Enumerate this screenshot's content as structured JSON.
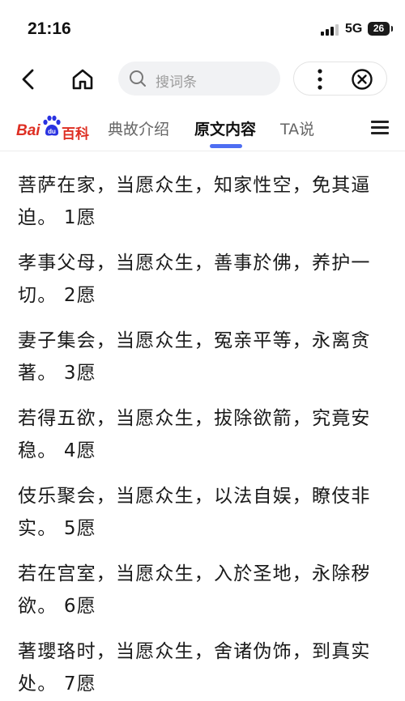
{
  "status_bar": {
    "time": "21:16",
    "network": "5G",
    "battery": "26"
  },
  "nav": {
    "search_placeholder": "搜词条",
    "icons": {
      "back": "chevron-left-icon",
      "home": "home-icon",
      "search": "search-icon",
      "more": "more-vertical-icon",
      "close": "close-circle-icon"
    }
  },
  "tabs": {
    "logo_bai": "Bai",
    "logo_ke": "百科",
    "items": [
      "典故介绍",
      "原文内容",
      "TA说"
    ],
    "active": "原文内容"
  },
  "content": {
    "paragraphs": [
      {
        "line1": "菩萨在家，当愿众生，知家性空，免其逼",
        "line2": "迫。 1愿"
      },
      {
        "line1": "孝事父母，当愿众生，善事於佛，养护一",
        "line2": "切。 2愿"
      },
      {
        "line1": "妻子集会，当愿众生，冤亲平等，永离贪",
        "line2": "著。 3愿"
      },
      {
        "line1": "若得五欲，当愿众生，拔除欲箭，究竟安",
        "line2": "稳。 4愿"
      },
      {
        "line1": "伎乐聚会，当愿众生，以法自娱，瞭伎非",
        "line2": "实。 5愿"
      },
      {
        "line1": "若在宫室，当愿众生，入於圣地，永除秽",
        "line2": "欲。 6愿"
      },
      {
        "line1": "著瓔珞时，当愿众生，舍诸伪饰，到真实",
        "line2": "处。 7愿"
      }
    ]
  },
  "colors": {
    "accent": "#4e6ef2",
    "brand_red": "#de2f23",
    "brand_blue": "#2932e1"
  }
}
